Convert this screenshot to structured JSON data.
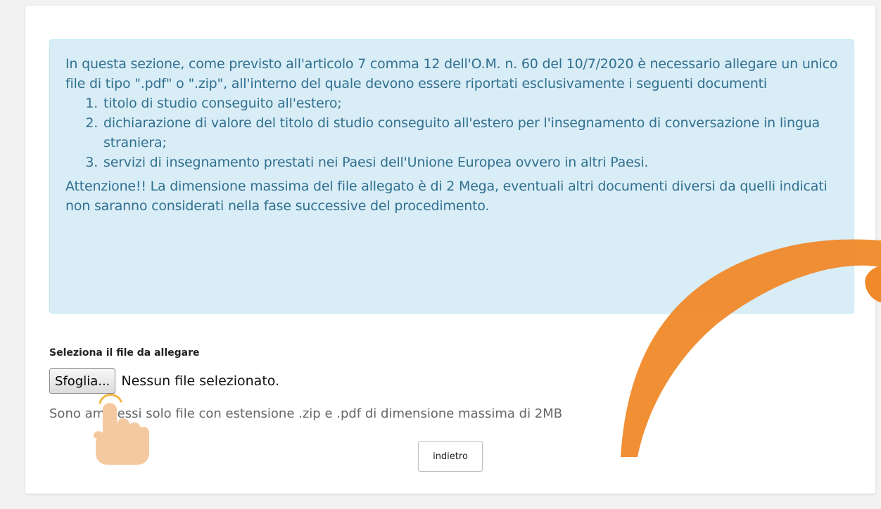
{
  "info": {
    "intro": "In questa sezione, come previsto all'articolo 7 comma 12 dell'O.M. n. 60 del 10/7/2020 è necessario allegare un unico file di tipo \".pdf\" o \".zip\", all'interno del quale devono essere riportati esclusivamente i seguenti documenti",
    "items": [
      "titolo di studio conseguito all'estero;",
      "dichiarazione di valore del titolo di studio conseguito all'estero per l'insegnamento di conversazione in lingua straniera;",
      "servizi di insegnamento prestati nei Paesi dell'Unione Europea ovvero in altri Paesi."
    ],
    "warning": "Attenzione!! La dimensione massima del file allegato è di 2 Mega, eventuali altri documenti diversi da quelli indicati non saranno considerati nella fase successive del procedimento."
  },
  "upload": {
    "label": "Seleziona il file da allegare",
    "browse_label": "Sfoglia...",
    "status": "Nessun file selezionato.",
    "help": "Sono ammessi solo file con estensione .zip e .pdf di dimensione massima di 2MB"
  },
  "actions": {
    "back_label": "indietro"
  },
  "colors": {
    "info_bg": "#d9edf7",
    "info_text": "#31708f",
    "swoosh": "#f0892a",
    "hand": "#f5c9a0"
  },
  "icons": {
    "pointer": "hand-pointer-icon",
    "swoosh": "orange-swoosh-decoration"
  }
}
